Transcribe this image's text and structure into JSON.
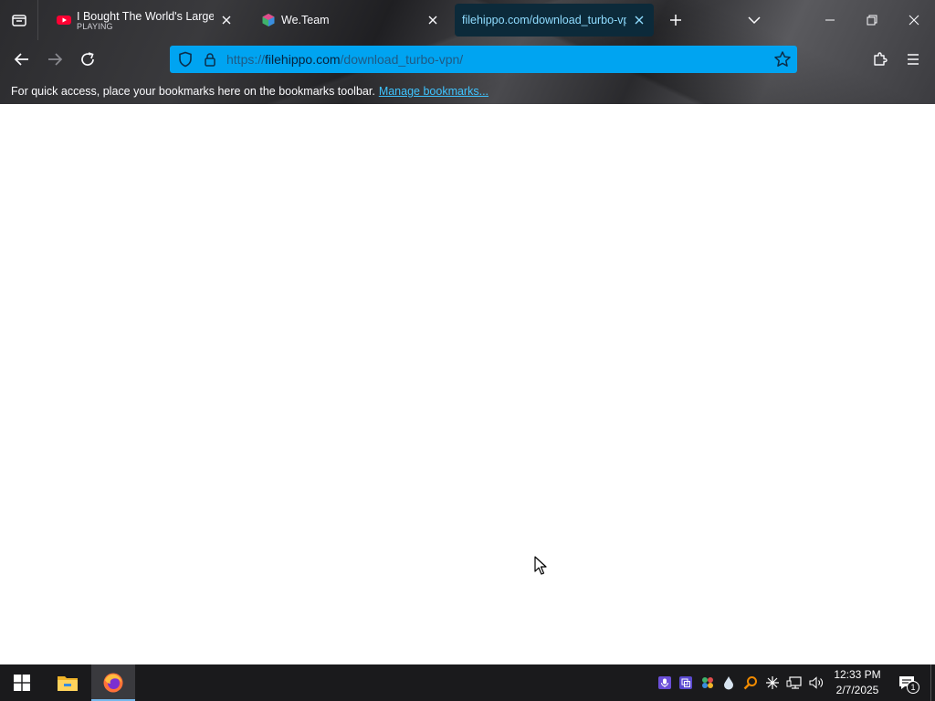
{
  "browser": {
    "tabs": [
      {
        "title": "I Bought The World's Largest M",
        "subtitle": "PLAYING",
        "favicon": "youtube-icon"
      },
      {
        "title": "We.Team",
        "subtitle": "",
        "favicon": "weteam-icon"
      },
      {
        "title": "filehippo.com/download_turbo-vpn",
        "subtitle": "",
        "favicon": "",
        "active": true
      }
    ],
    "url": {
      "scheme": "https://",
      "host": "filehippo.com",
      "path": "/download_turbo-vpn/"
    },
    "bookmarks_bar": {
      "message": "For quick access, place your bookmarks here on the bookmarks toolbar.",
      "link": "Manage bookmarks..."
    },
    "accent_color": "#00a4f1"
  },
  "taskbar": {
    "clock": {
      "time": "12:33 PM",
      "date": "2/7/2025"
    },
    "notification_count": "1",
    "pinned": [
      "file-explorer-icon",
      "firefox-icon"
    ],
    "tray": [
      "microphone-icon",
      "copy-icon",
      "network-tool-icon",
      "droplet-icon",
      "search-tool-icon",
      "sparkle-icon",
      "network-icon",
      "volume-icon"
    ]
  }
}
